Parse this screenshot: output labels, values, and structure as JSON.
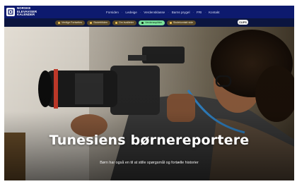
{
  "site": {
    "logo_text_line1": "NORSKE",
    "logo_text_line2": "ELEVAVISER",
    "logo_text_line3": "KALENDER"
  },
  "top_nav": [
    "Forsiden",
    "Ledeige",
    "Verdensklasse",
    "Barns prygel",
    "FRI",
    "Kontakt"
  ],
  "filter_pills": [
    {
      "label": "Verdige Fortsettes",
      "active": false
    },
    {
      "label": "Skolefritiden",
      "active": false
    },
    {
      "label": "Om kvaliteter",
      "active": false
    },
    {
      "label": "Verdenssplitter",
      "active": true
    },
    {
      "label": "Skolekontakt side",
      "active": false
    }
  ],
  "corner_badge": "CLIPS",
  "hero": {
    "title": "Tunesiens børnereportere",
    "subtitle": "Børn har også en til at stille spørgsmål og fortælle historier"
  },
  "colors": {
    "header_bg": "#0d1a6e",
    "pill_row_bg": "#0b153f",
    "pill_bg": "#5a4a2a",
    "pill_active_bg": "#7be09a"
  }
}
